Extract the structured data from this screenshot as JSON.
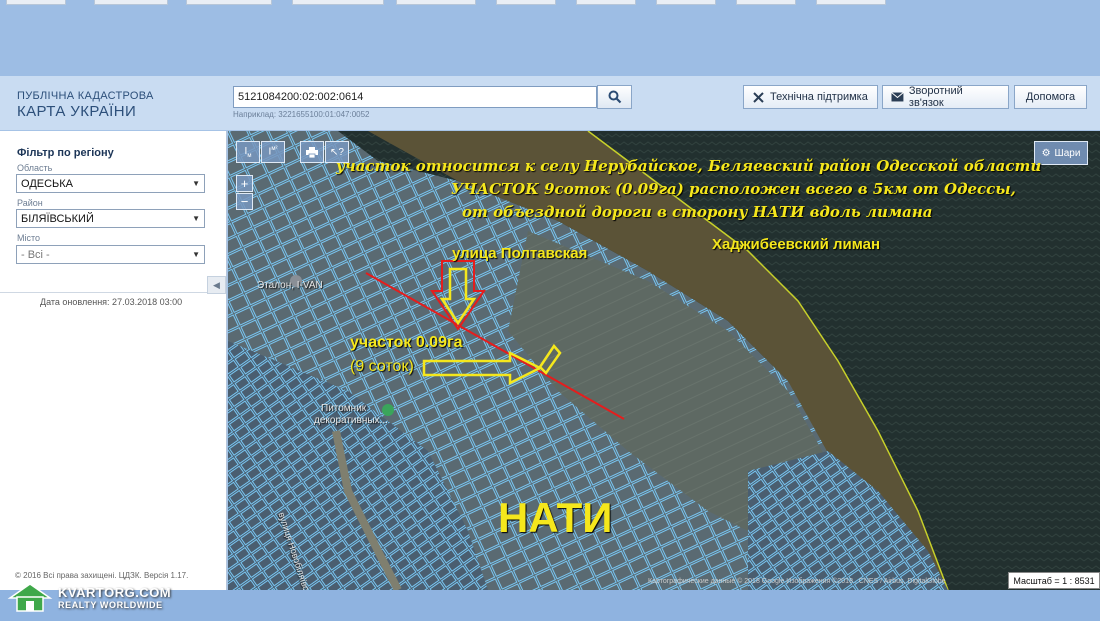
{
  "header": {
    "logo_line1": "ПУБЛІЧНА КАДАСТРОВА",
    "logo_line2": "КАРТА УКРАЇНИ",
    "search_value": "5121084200:02:002:0614",
    "search_hint": "Наприклад: 3221655100:01:047:0052",
    "support_label": "Технічна підтримка",
    "feedback_label": "Зворотний зв'язок",
    "help_label": "Допомога"
  },
  "filter": {
    "title": "Фільтр по регіону",
    "oblast_label": "Область",
    "oblast_value": "ОДЕСЬКА",
    "raion_label": "Район",
    "raion_value": "БІЛЯЇВСЬКИЙ",
    "misto_label": "Місто",
    "misto_value": "- Всі -",
    "updated": "Дата оновлення: 27.03.2018 03:00",
    "copyright": "© 2016 Всі права захищені. ЦДЗК. Версія 1.17."
  },
  "map": {
    "layers_label": "Шари",
    "zoom_in": "+",
    "zoom_out": "−",
    "annotation_1": "участок относится к селу Нерубайское, Беляевский район Одесской области",
    "annotation_2": "УЧАСТОК  9соток (0.09га) расположен всего в 5км от Одессы,",
    "annotation_3": "от объездной дороги в сторону НАТИ вдоль лимана",
    "annotation_4": "Хаджибеевский лиман",
    "annotation_street": "улица Полтавская",
    "annotation_plot1": "участок 0.09га",
    "annotation_plot2": "(9 соток)",
    "annotation_nati": "НАТИ",
    "poi_etalon": "Эталон, I-VAN",
    "poi_nursery1": "Питомник",
    "poi_nursery2": "декоративных...",
    "street_vertical": "вулиця Новобіляївська",
    "attribution": "Картографические данные © 2018 Google  Изображения ©2018 , CNES / Airbus, DigitalGlobe",
    "scale": "Масштаб = 1 : 8531"
  },
  "watermark": {
    "line1": "KVARTORG.COM",
    "line2": "REALTY WORLDWIDE"
  },
  "colors": {
    "annotation": "#f5e71c",
    "marker_line": "#e51d1d",
    "parcel_outline": "#79c6f2",
    "header_bg": "#c9dcf2"
  }
}
